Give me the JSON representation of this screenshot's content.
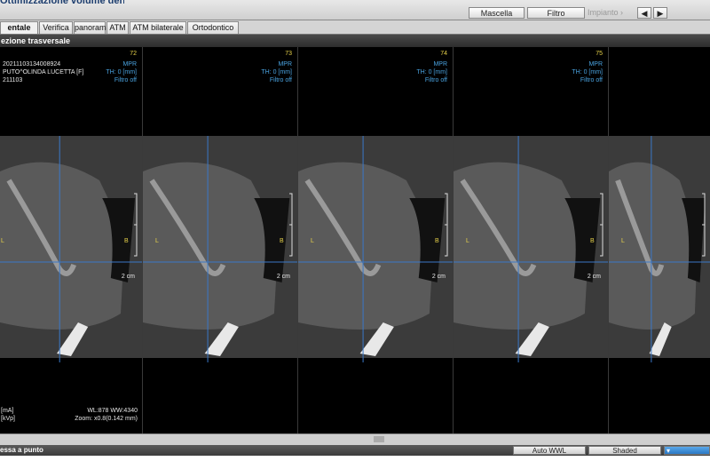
{
  "window": {
    "title": "Ottimizzazione volume dentale"
  },
  "toolbar": {
    "mascella_label": "Mascella",
    "filtro_label": "Filtro",
    "impianto_label": "Impianto"
  },
  "tabs": [
    {
      "label": "entale",
      "active": true
    },
    {
      "label": "Verifica",
      "active": false
    },
    {
      "label": "panorama",
      "active": false
    },
    {
      "label": "ATM",
      "active": false
    },
    {
      "label": "ATM bilaterale",
      "active": false
    },
    {
      "label": "Ortodontico",
      "active": false
    }
  ],
  "section_header": "ezione trasversale",
  "patient": {
    "id": "20211103134008924",
    "name": "PUTO^OLINDA LUCETTA [F]",
    "date": "211103"
  },
  "panels": [
    {
      "slice": "72",
      "mode": "MPR",
      "thickness": "TH: 0 [mm]",
      "filter": "Filtro off",
      "left_marker": "L",
      "right_marker": "B",
      "scale": "2 cm"
    },
    {
      "slice": "73",
      "mode": "MPR",
      "thickness": "TH: 0 [mm]",
      "filter": "Filtro off",
      "left_marker": "L",
      "right_marker": "B",
      "scale": "2 cm"
    },
    {
      "slice": "74",
      "mode": "MPR",
      "thickness": "TH: 0 [mm]",
      "filter": "Filtro off",
      "left_marker": "L",
      "right_marker": "B",
      "scale": "2 cm"
    },
    {
      "slice": "75",
      "mode": "MPR",
      "thickness": "TH: 0 [mm]",
      "filter": "Filtro off",
      "left_marker": "L",
      "right_marker": "B",
      "scale": "2 cm"
    },
    {
      "slice": "",
      "mode": "",
      "thickness": "",
      "filter": "",
      "left_marker": "L",
      "right_marker": "",
      "scale": ""
    }
  ],
  "exposure": {
    "ma_label": "[mA]",
    "kvp_label": "[kVp]"
  },
  "window_level": {
    "wl_ww": "WL:878 WW:4340",
    "zoom": "Zoom: x0.8(0.142 mm)"
  },
  "statusbar": {
    "status_text": "essa a punto",
    "auto_wwl_label": "Auto WWL",
    "shaded_label": "Shaded"
  },
  "colors": {
    "crosshair": "#3a78c8",
    "overlay_yellow": "#e8d34a",
    "overlay_blue": "#4aa3e0",
    "header_dark": "#2d2d2d",
    "active_button": "#2a78c4"
  }
}
